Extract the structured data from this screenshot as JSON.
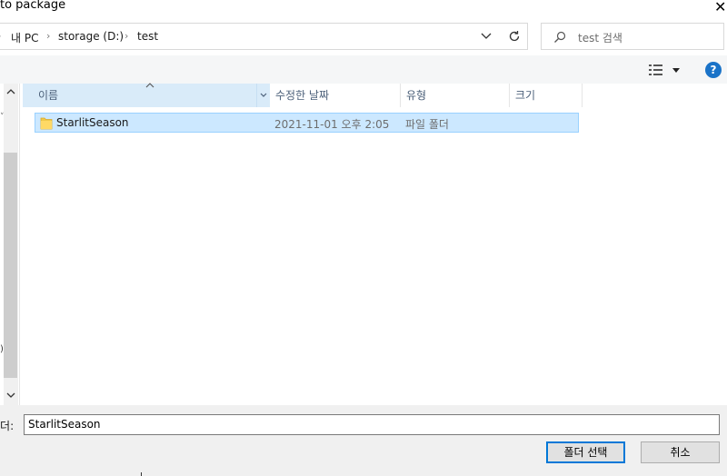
{
  "window": {
    "title": "to package",
    "close_glyph": "✕"
  },
  "address_bar": {
    "breadcrumb": [
      "내 PC",
      "storage (D:)",
      "test"
    ],
    "refresh_icon": "refresh-icon",
    "dropdown_icon": "chevron-down-icon"
  },
  "search": {
    "placeholder": "test 검색"
  },
  "command_bar": {
    "help_label": "?"
  },
  "file_list": {
    "columns": [
      "이름",
      "수정한 날짜",
      "유형",
      "크기"
    ],
    "rows": [
      {
        "name": "StarlitSeason",
        "modified": "2021-11-01 오후 2:05",
        "type": "파일 폴더",
        "size": "",
        "selected": true
      }
    ]
  },
  "nav_pane": {
    "edge_text": ")"
  },
  "footer": {
    "folder_label": "폴더:",
    "folder_value": "StarlitSeason",
    "select_button": "폴더 선택",
    "cancel_button": "취소"
  },
  "colors": {
    "selection_bg": "#cce8ff",
    "selection_border": "#99d1ff",
    "header_hover_bg": "#d9ebf9",
    "primary_button_border": "#0078d7",
    "help_icon_bg": "#1a73c8"
  }
}
